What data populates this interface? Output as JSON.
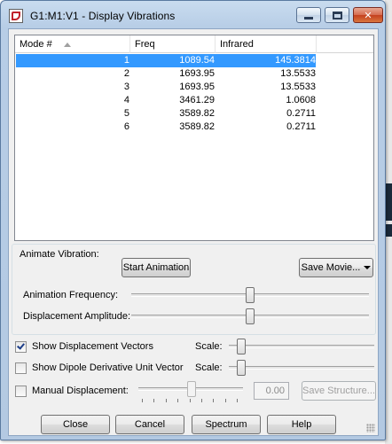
{
  "window": {
    "title": "G1:M1:V1 - Display Vibrations"
  },
  "list": {
    "headers": [
      "Mode #",
      "Freq",
      "Infrared"
    ],
    "rows": [
      {
        "mode": "1",
        "freq": "1089.54",
        "ir": "145.3814"
      },
      {
        "mode": "2",
        "freq": "1693.95",
        "ir": "13.5533"
      },
      {
        "mode": "3",
        "freq": "1693.95",
        "ir": "13.5533"
      },
      {
        "mode": "4",
        "freq": "3461.29",
        "ir": "1.0608"
      },
      {
        "mode": "5",
        "freq": "3589.82",
        "ir": "0.2711"
      },
      {
        "mode": "6",
        "freq": "3589.82",
        "ir": "0.2711"
      }
    ],
    "selected_index": 0
  },
  "animate": {
    "group_label": "Animate Vibration:",
    "start_label": "Start Animation",
    "save_movie_label": "Save Movie...",
    "frequency_label": "Animation Frequency:",
    "frequency_level": 0.5,
    "amplitude_label": "Displacement Amplitude:",
    "amplitude_level": 0.5
  },
  "options": {
    "show_vectors_label": "Show Displacement Vectors",
    "show_vectors_checked": true,
    "show_dipole_label": "Show Dipole Derivative Unit Vector",
    "show_dipole_checked": false,
    "scale_label": "Scale:",
    "manual_label": "Manual Displacement:",
    "manual_checked": false,
    "manual_value": "0.00",
    "save_structure_label": "Save Structure..."
  },
  "footer": {
    "close_label": "Close",
    "cancel_label": "Cancel",
    "spectrum_label": "Spectrum",
    "help_label": "Help"
  },
  "colors": {
    "selection": "#3399ff",
    "titlebar": "#b9cfe7",
    "close_button": "#c4401f"
  }
}
